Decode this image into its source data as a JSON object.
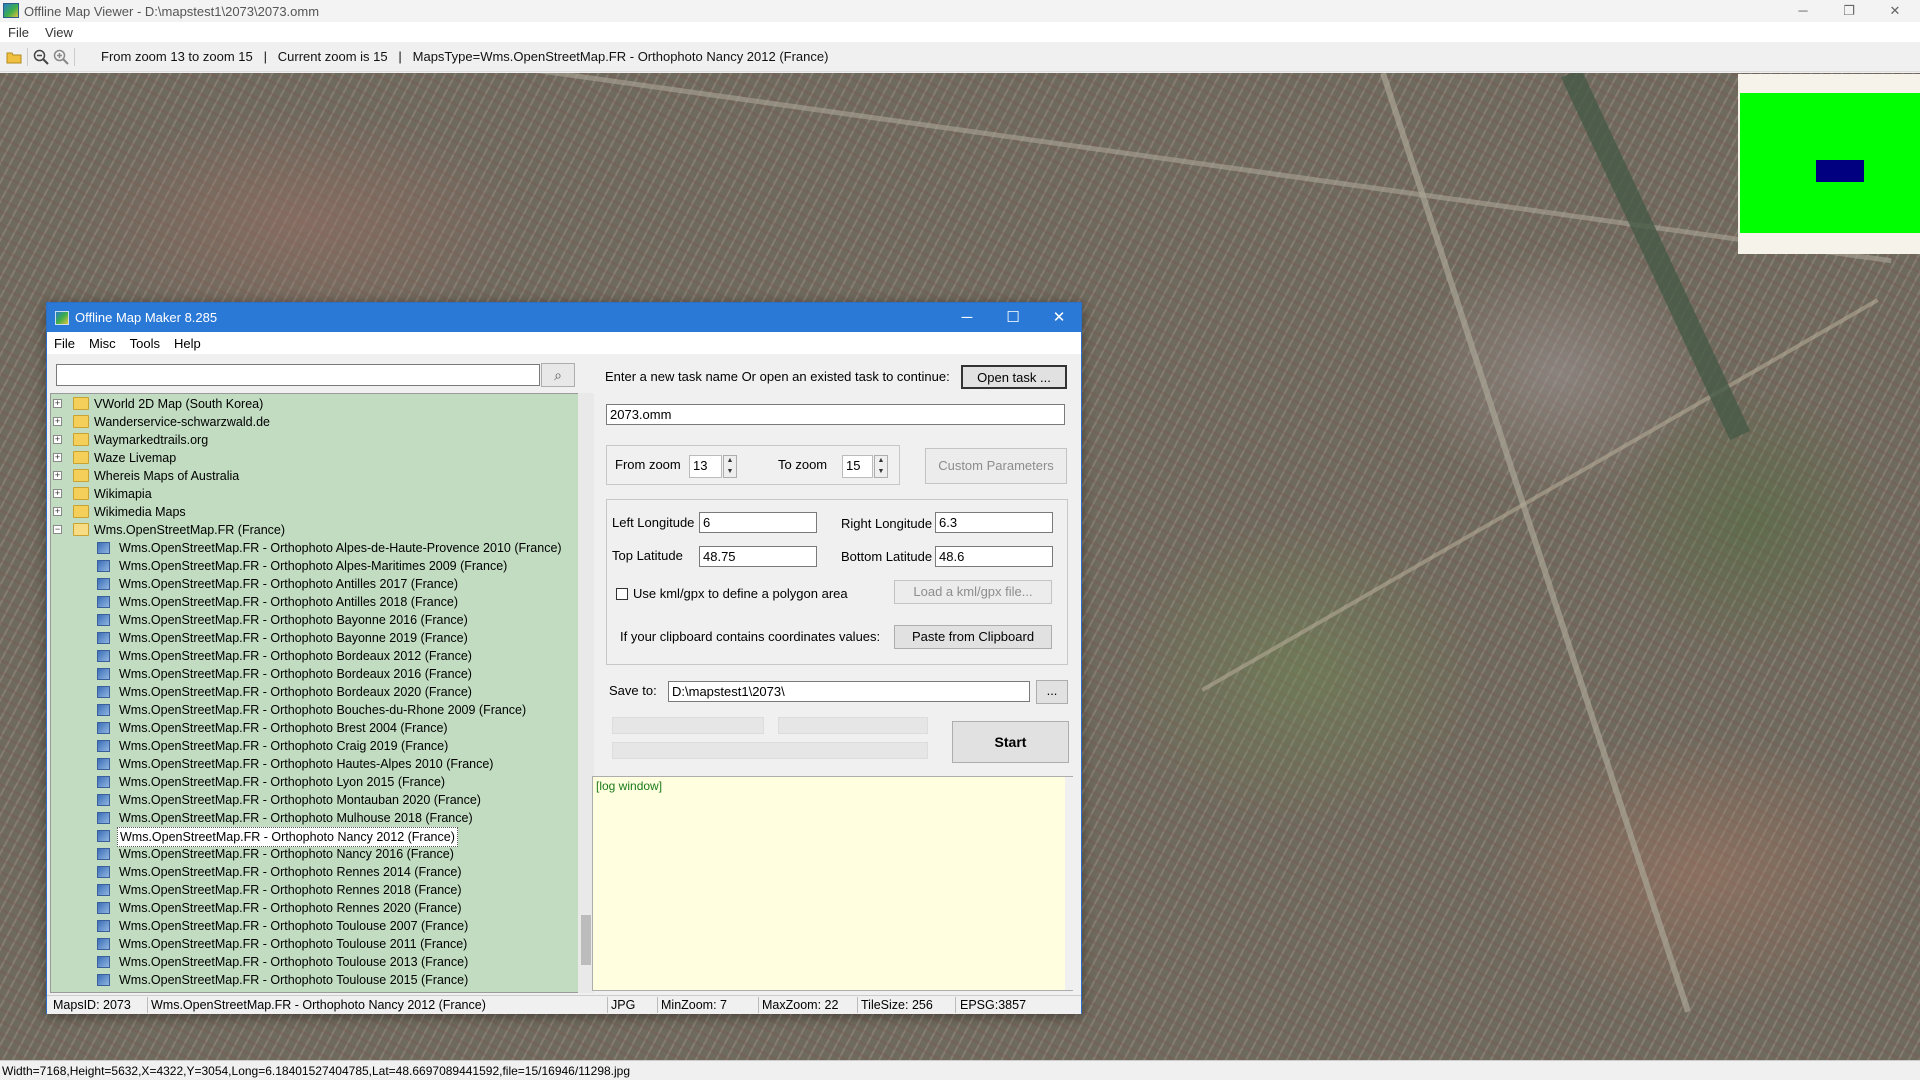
{
  "window": {
    "title": "Offline Map Viewer - D:\\mapstest1\\2073\\2073.omm",
    "minimize": "─",
    "restore": "❐",
    "close": "✕"
  },
  "menu": [
    "File",
    "View"
  ],
  "toolbar": {
    "info": "From zoom 13 to zoom 15   |   Current zoom is 15   |   MapsType=Wms.OpenStreetMap.FR - Orthophoto Nancy 2012 (France)"
  },
  "statusbar": {
    "text": "Width=7168,Height=5632,X=4322,Y=3054,Long=6.18401527404785,Lat=48.6697089441592,file=15/16946/11298.jpg"
  },
  "dialog": {
    "title": "Offline Map Maker 8.285",
    "menu": [
      "File",
      "Misc",
      "Tools",
      "Help"
    ],
    "search_placeholder": "",
    "tree": {
      "folders": [
        "VWorld 2D Map (South Korea)",
        "Wanderservice-schwarzwald.de",
        "Waymarkedtrails.org",
        "Waze Livemap",
        "Whereis Maps of Australia",
        "Wikimapia",
        "Wikimedia Maps"
      ],
      "open_folder": "Wms.OpenStreetMap.FR (France)",
      "items": [
        "Wms.OpenStreetMap.FR - Orthophoto Alpes-de-Haute-Provence 2010 (France)",
        "Wms.OpenStreetMap.FR - Orthophoto Alpes-Maritimes 2009 (France)",
        "Wms.OpenStreetMap.FR - Orthophoto Antilles 2017 (France)",
        "Wms.OpenStreetMap.FR - Orthophoto Antilles 2018 (France)",
        "Wms.OpenStreetMap.FR - Orthophoto Bayonne 2016 (France)",
        "Wms.OpenStreetMap.FR - Orthophoto Bayonne 2019 (France)",
        "Wms.OpenStreetMap.FR - Orthophoto Bordeaux 2012 (France)",
        "Wms.OpenStreetMap.FR - Orthophoto Bordeaux 2016 (France)",
        "Wms.OpenStreetMap.FR - Orthophoto Bordeaux 2020 (France)",
        "Wms.OpenStreetMap.FR - Orthophoto Bouches-du-Rhone 2009 (France)",
        "Wms.OpenStreetMap.FR - Orthophoto Brest 2004 (France)",
        "Wms.OpenStreetMap.FR - Orthophoto Craig 2019 (France)",
        "Wms.OpenStreetMap.FR - Orthophoto Hautes-Alpes 2010 (France)",
        "Wms.OpenStreetMap.FR - Orthophoto Lyon 2015 (France)",
        "Wms.OpenStreetMap.FR - Orthophoto Montauban 2020 (France)",
        "Wms.OpenStreetMap.FR - Orthophoto Mulhouse 2018 (France)",
        "Wms.OpenStreetMap.FR - Orthophoto Nancy 2012 (France)",
        "Wms.OpenStreetMap.FR - Orthophoto Nancy 2016 (France)",
        "Wms.OpenStreetMap.FR - Orthophoto Rennes 2014 (France)",
        "Wms.OpenStreetMap.FR - Orthophoto Rennes 2018 (France)",
        "Wms.OpenStreetMap.FR - Orthophoto Rennes 2020 (France)",
        "Wms.OpenStreetMap.FR - Orthophoto Toulouse 2007 (France)",
        "Wms.OpenStreetMap.FR - Orthophoto Toulouse 2011 (France)",
        "Wms.OpenStreetMap.FR - Orthophoto Toulouse 2013 (France)",
        "Wms.OpenStreetMap.FR - Orthophoto Toulouse 2015 (France)"
      ],
      "selected_item": "Wms.OpenStreetMap.FR - Orthophoto Nancy 2012 (France)"
    },
    "task_prompt": "Enter a new task name Or open an existed task to continue:",
    "open_task_button": "Open task ...",
    "task_name": "2073.omm",
    "from_zoom_label": "From zoom",
    "from_zoom": "13",
    "to_zoom_label": "To zoom",
    "to_zoom": "15",
    "custom_params_button": "Custom Parameters",
    "left_longitude_label": "Left Longitude",
    "left_longitude": "6",
    "right_longitude_label": "Right Longitude",
    "right_longitude": "6.3",
    "top_latitude_label": "Top Latitude",
    "top_latitude": "48.75",
    "bottom_latitude_label": "Bottom Latitude",
    "bottom_latitude": "48.6",
    "kml_checkbox_label": "Use kml/gpx to define a polygon area",
    "load_kml_button": "Load a kml/gpx file...",
    "clipboard_label": "If your clipboard contains coordinates values:",
    "paste_button": "Paste from Clipboard",
    "save_to_label": "Save to:",
    "save_to": "D:\\mapstest1\\2073\\",
    "browse_button": "...",
    "start_button": "Start",
    "log": "[log window]",
    "status": {
      "maps_id": "MapsID: 2073",
      "maps_name": "Wms.OpenStreetMap.FR - Orthophoto Nancy 2012 (France)",
      "format": "JPG",
      "min_zoom": "MinZoom: 7",
      "max_zoom": "MaxZoom: 22",
      "tile_size": "TileSize: 256",
      "epsg": "EPSG:3857"
    }
  },
  "colors": {
    "dialog_title": "#2b79d7",
    "tree_bg": "#c2dcc2",
    "log_bg": "#ffffe0",
    "minimap_bg": "#00ff00",
    "minimap_view": "#000080"
  }
}
